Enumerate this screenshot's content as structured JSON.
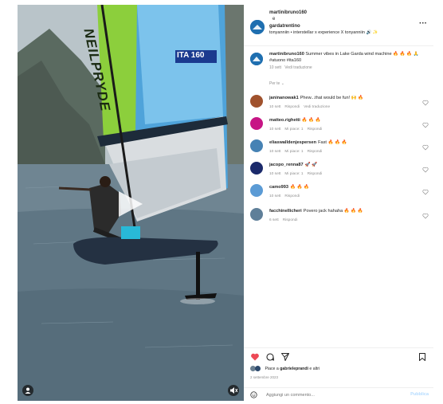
{
  "header": {
    "username": "martinibruno160",
    "separator": "e",
    "collab": "gardatrentino",
    "audio": "tonyanniin • interstellar x experience X tonyanniin 🔊 ✨",
    "more_label": "···"
  },
  "caption": {
    "username": "martinibruno160",
    "text": "Summer vibes in Lake Garda wind machine 🔥 🔥 🔥 🙏 #atuono #ita160",
    "time": "10 sett",
    "translate": "Vedi traduzione"
  },
  "per_te": "Per te ⌄",
  "comments": [
    {
      "user": "janinanowak1",
      "text": "Phew...that would be fun! 🙌 🔥",
      "time": "10 sett",
      "reply": "Rispondi",
      "extra": "Vedi traduzione",
      "likes": "",
      "avatar_color": "#a0522d"
    },
    {
      "user": "matteo.righetti",
      "text": "🔥 🔥 🔥",
      "time": "10 sett",
      "reply": "Rispondi",
      "extra": "",
      "likes": "Mi piace: 1",
      "avatar_color": "#c71585"
    },
    {
      "user": "eliaswalldenjespersen",
      "text": "Fast 🔥 🔥 🔥",
      "time": "10 sett",
      "reply": "Rispondi",
      "extra": "",
      "likes": "Mi piace: 1",
      "avatar_color": "#4682b4"
    },
    {
      "user": "jacopo_renna87",
      "text": "🚀 🚀",
      "time": "10 sett",
      "reply": "Rispondi",
      "extra": "",
      "likes": "Mi piace: 1",
      "avatar_color": "#1b2a6b"
    },
    {
      "user": "camo993",
      "text": "🔥 🔥 🔥",
      "time": "10 sett",
      "reply": "Rispondi",
      "extra": "",
      "likes": "",
      "avatar_color": "#5b9bd5"
    },
    {
      "user": "facchinellicheri",
      "text": "Povero jack hahaha 🔥 🔥 🔥",
      "time": "6 sett",
      "reply": "Rispondi",
      "extra": "",
      "likes": "",
      "avatar_color": "#5f7f99"
    }
  ],
  "likes": {
    "prefix": "Piace a",
    "name": "gabrieleprandi",
    "suffix": "e altri"
  },
  "date": "2 settembre 2023",
  "add_comment": {
    "placeholder": "Aggiungi un commento...",
    "publish": "Pubblica"
  },
  "sail": {
    "brand": "NEILPRYDE",
    "model": "ITA 160"
  },
  "colors": {
    "like_red": "#ed4956",
    "link_blue": "#b3dbff",
    "meta_gray": "#8e8e8e"
  },
  "icons": [
    "ellipsis-icon",
    "heart-icon",
    "comment-icon",
    "share-icon",
    "bookmark-icon",
    "emoji-icon",
    "play-icon",
    "audio-icon",
    "user-tag-icon"
  ]
}
